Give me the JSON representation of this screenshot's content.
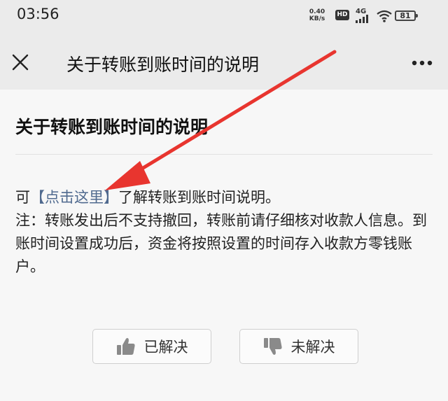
{
  "status_bar": {
    "time": "03:56",
    "net_speed_value": "0.40",
    "net_speed_unit": "KB/s",
    "hd_label": "HD",
    "net_type": "4G",
    "battery": "81"
  },
  "nav": {
    "title": "关于转账到账时间的说明"
  },
  "article": {
    "title": "关于转账到账时间的说明",
    "line1_prefix": "可",
    "link_text": "【点击这里】",
    "line1_suffix": "了解转账到账时间说明。",
    "note": "注：转账发出后不支持撤回，转账前请仔细核对收款人信息。到账时间设置成功后，资金将按照设置的时间存入收款方零钱账户。"
  },
  "feedback": {
    "solved_label": "已解决",
    "unsolved_label": "未解决"
  },
  "colors": {
    "link": "#506a8f",
    "arrow": "#e8352f"
  }
}
